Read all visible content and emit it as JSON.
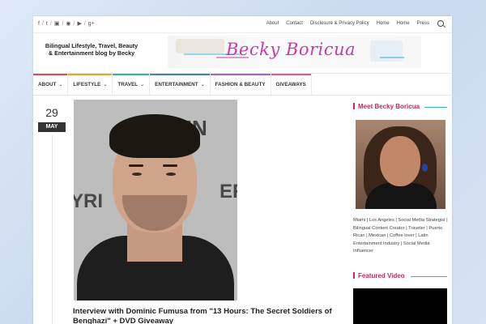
{
  "social_icons": [
    "facebook-icon",
    "twitter-icon",
    "instagram-icon",
    "pinterest-icon",
    "youtube-icon",
    "googleplus-icon"
  ],
  "social_glyphs": [
    "f",
    "t",
    "▣",
    "◉",
    "▶",
    "g+"
  ],
  "topnav": [
    "About",
    "Contact",
    "Disclosure & Privacy Policy",
    "Home",
    "Home",
    "Press"
  ],
  "header": {
    "tagline": "Bilingual Lifestyle, Travel, Beauty & Entertainment blog by Becky",
    "logo_text": "Becky Boricua"
  },
  "mainnav": [
    {
      "label": "ABOUT",
      "chevron": "⌄",
      "color": "#e34a4a"
    },
    {
      "label": "LIFESTYLE",
      "chevron": "⌄",
      "color": "#f2a21f"
    },
    {
      "label": "TRAVEL",
      "chevron": "⌄",
      "color": "#2fb3a6"
    },
    {
      "label": "ENTERTAINMENT",
      "chevron": "⌄",
      "color": "#3a7fd0"
    },
    {
      "label": "FASHION & BEAUTY",
      "chevron": "",
      "color": "#b05fc6"
    },
    {
      "label": "GIVEAWAYS",
      "chevron": "",
      "color": "#e3568f"
    }
  ],
  "post": {
    "day": "29",
    "month": "MAY",
    "photo_text": [
      "RIN",
      "YRI",
      "ER"
    ],
    "title": "Interview with Dominic Fumusa from \"13 Hours: The Secret Soldiers of Benghazi\" + DVD Giveaway"
  },
  "sidebar": {
    "meet_title": "Meet Becky Boricua",
    "bio": "Miami | Los Angeles | Social Media Strategist | Bilingual Content Creator | Traveler | Puerto Rican | Mexican | Coffee lover | Latin Entertainment Industry | Social Media Influencer",
    "video_title": "Featured Video"
  },
  "colors": {
    "accent": "#c22a5a",
    "teal_line": "#3bb7b0",
    "logo": "#c73aa8"
  }
}
